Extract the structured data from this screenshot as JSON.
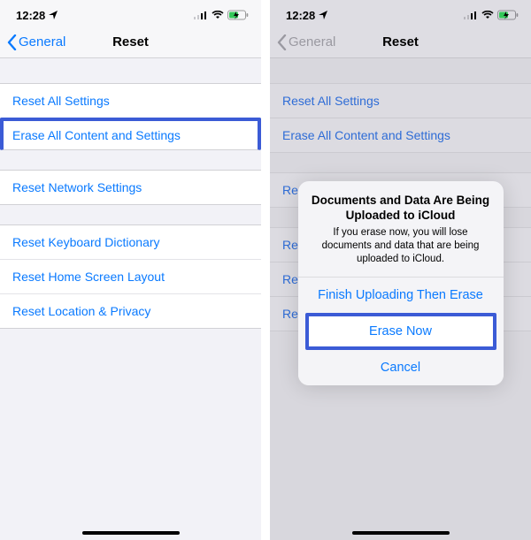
{
  "status": {
    "time": "12:28"
  },
  "nav": {
    "back": "General",
    "title": "Reset"
  },
  "rows": {
    "reset_all": "Reset All Settings",
    "erase_all": "Erase All Content and Settings",
    "reset_network": "Reset Network Settings",
    "reset_keyboard": "Reset Keyboard Dictionary",
    "reset_home": "Reset Home Screen Layout",
    "reset_location": "Reset Location & Privacy"
  },
  "right": {
    "rows_trunc": {
      "r1": "Rese",
      "r2": "Rese",
      "r3": "Rese"
    }
  },
  "alert": {
    "title": "Documents and Data Are Being Uploaded to iCloud",
    "message": "If you erase now, you will lose documents and data that are being uploaded to iCloud.",
    "btn1": "Finish Uploading Then Erase",
    "btn2": "Erase Now",
    "btn3": "Cancel"
  }
}
